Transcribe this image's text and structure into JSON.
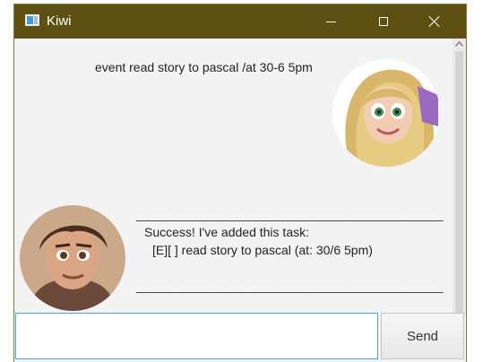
{
  "window": {
    "title": "Kiwi",
    "accent_color": "#5e5012"
  },
  "dialog": {
    "user_message": "event read story to pascal /at 30-6 5pm",
    "bot_response": {
      "rule_top": "____________________________________________",
      "line1": "Success! I've added this task:",
      "line2": "[E][ ] read story to pascal (at: 30/6 5pm)",
      "rule_bottom": "____________________________________________"
    }
  },
  "input": {
    "value": "",
    "placeholder": ""
  },
  "send_button": {
    "label": "Send"
  },
  "icons": {
    "app": "app-window-icon",
    "minimize": "minimize-icon",
    "maximize": "maximize-icon",
    "close": "close-icon",
    "scroll_up": "chevron-up-icon"
  }
}
